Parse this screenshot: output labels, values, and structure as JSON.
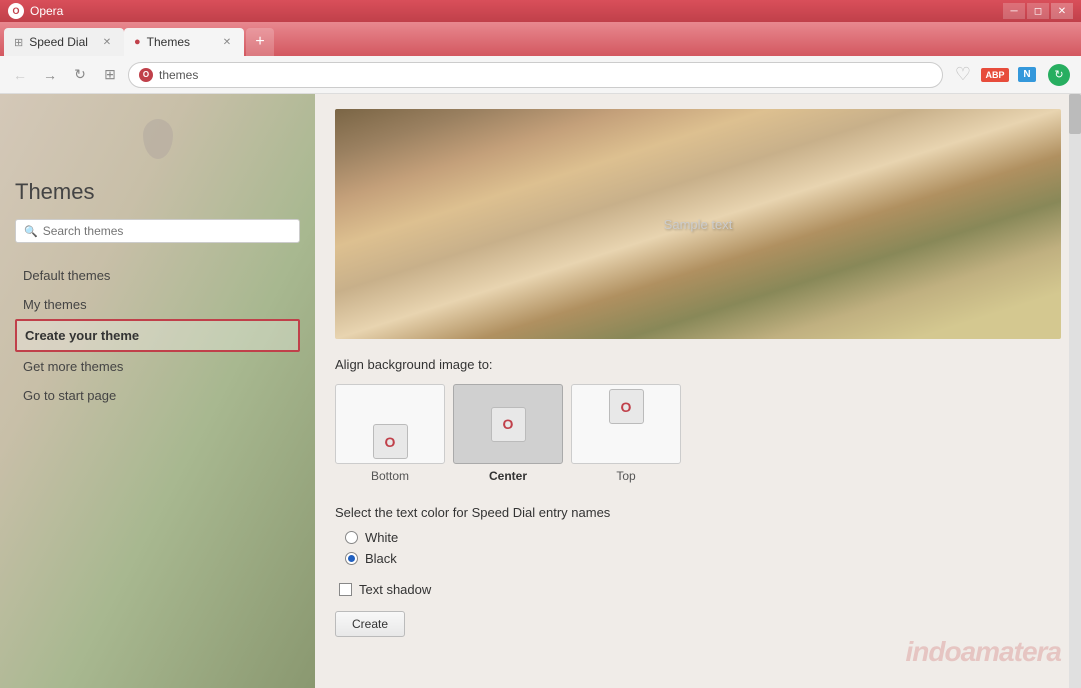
{
  "titlebar": {
    "app_name": "Opera",
    "minimize_label": "─",
    "restore_label": "◻",
    "close_label": "✕"
  },
  "tabs": [
    {
      "id": "speed-dial",
      "label": "Speed Dial",
      "icon": "⊞",
      "active": false
    },
    {
      "id": "themes",
      "label": "Themes",
      "icon": "◉",
      "active": true
    }
  ],
  "tab_new_label": "+",
  "addressbar": {
    "back_label": "←",
    "forward_label": "→",
    "refresh_label": "↻",
    "speeddial_label": "⊞",
    "opera_icon": "O",
    "url": "themes",
    "heart_label": "♡",
    "abp_label": "ABP",
    "n_label": "N",
    "update_label": "↻"
  },
  "sidebar": {
    "drop_logo": "",
    "title": "Themes",
    "search_placeholder": "Search themes",
    "nav_items": [
      {
        "id": "default",
        "label": "Default themes",
        "active": false
      },
      {
        "id": "my",
        "label": "My themes",
        "active": false
      },
      {
        "id": "create",
        "label": "Create your theme",
        "active": true
      },
      {
        "id": "more",
        "label": "Get more themes",
        "active": false
      },
      {
        "id": "start",
        "label": "Go to start page",
        "active": false
      }
    ]
  },
  "content": {
    "preview_sample_text": "Sample text",
    "align_label": "Align background image to:",
    "align_options": [
      {
        "id": "bottom",
        "label": "Bottom",
        "selected": false
      },
      {
        "id": "center",
        "label": "Center",
        "selected": true
      },
      {
        "id": "top",
        "label": "Top",
        "selected": false
      }
    ],
    "text_color_label": "Select the text color for Speed Dial entry names",
    "color_options": [
      {
        "id": "white",
        "label": "White",
        "checked": false
      },
      {
        "id": "black",
        "label": "Black",
        "checked": true
      }
    ],
    "text_shadow_label": "Text shadow",
    "create_button_label": "Create"
  },
  "watermark": "indoamatera"
}
